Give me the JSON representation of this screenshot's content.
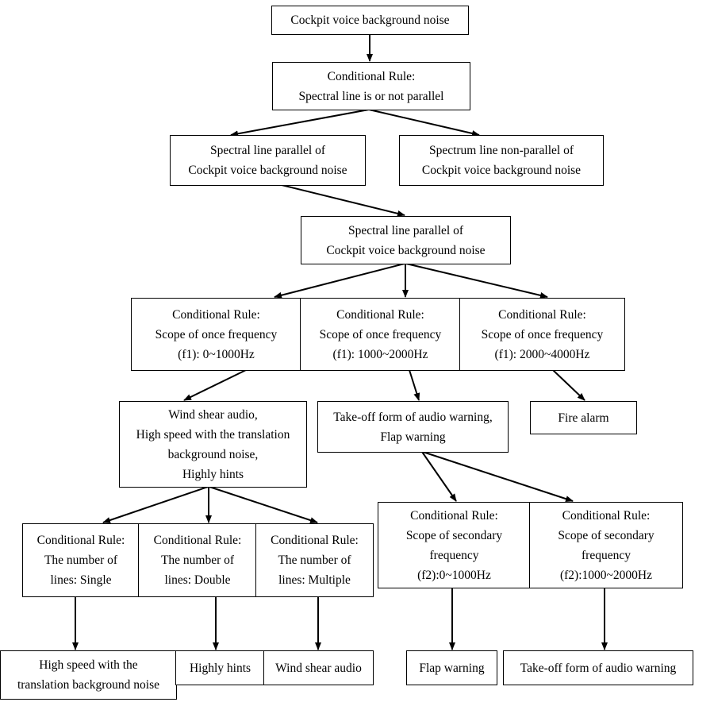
{
  "nodes": {
    "root": [
      "Cockpit voice background noise"
    ],
    "rule1": [
      "Conditional Rule:",
      "Spectral line is or not parallel"
    ],
    "parallel": [
      "Spectral line parallel of",
      "Cockpit voice background noise"
    ],
    "nonparallel": [
      "Spectrum line non-parallel of",
      "Cockpit voice background noise"
    ],
    "parallel2": [
      "Spectral line parallel of",
      "Cockpit voice background noise"
    ],
    "f1_low": [
      "Conditional Rule:",
      "Scope of once frequency",
      "(f1): 0~1000Hz"
    ],
    "f1_mid": [
      "Conditional Rule:",
      "Scope of once frequency",
      "(f1): 1000~2000Hz"
    ],
    "f1_high": [
      "Conditional Rule:",
      "Scope of once frequency",
      "(f1): 2000~4000Hz"
    ],
    "group_low": [
      "Wind shear audio,",
      "High speed with the translation",
      "background noise,",
      "Highly hints"
    ],
    "group_mid": [
      "Take-off form of audio warning,",
      "Flap warning"
    ],
    "fire": [
      "Fire alarm"
    ],
    "lines_single": [
      "Conditional Rule:",
      "The number of",
      "lines: Single"
    ],
    "lines_double": [
      "Conditional Rule:",
      "The number of",
      "lines: Double"
    ],
    "lines_multiple": [
      "Conditional Rule:",
      "The number of",
      "lines: Multiple"
    ],
    "f2_low": [
      "Conditional Rule:",
      "Scope of secondary",
      "frequency",
      "(f2):0~1000Hz"
    ],
    "f2_high": [
      "Conditional Rule:",
      "Scope of secondary",
      "frequency",
      "(f2):1000~2000Hz"
    ],
    "out_highspeed": [
      "High speed with the",
      "translation background noise"
    ],
    "out_hints": [
      "Highly hints"
    ],
    "out_windshear": [
      "Wind shear audio"
    ],
    "out_flap": [
      "Flap warning"
    ],
    "out_takeoff": [
      "Take-off form of audio warning"
    ]
  }
}
